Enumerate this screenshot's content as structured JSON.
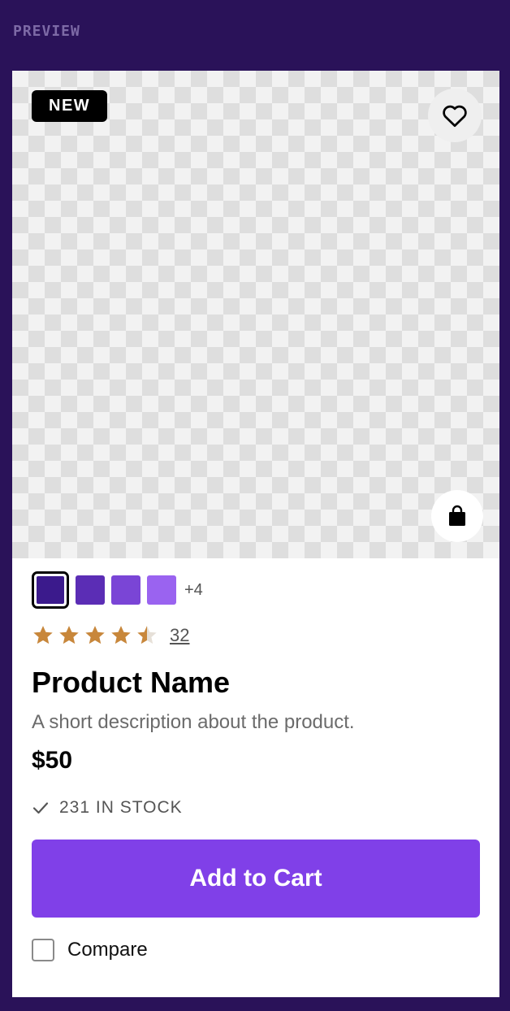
{
  "preview_label": "PREVIEW",
  "product": {
    "badge": "NEW",
    "title": "Product Name",
    "description": "A short description about the product.",
    "price": "$50",
    "rating": 4.5,
    "rating_max": 5,
    "review_count": "32",
    "stock_text": "231 IN STOCK",
    "swatches": [
      {
        "color": "#3b1a8c",
        "selected": true
      },
      {
        "color": "#5b2db5",
        "selected": false
      },
      {
        "color": "#7a45d6",
        "selected": false
      },
      {
        "color": "#9a63f0",
        "selected": false
      }
    ],
    "more_swatches": "+4",
    "add_to_cart_label": "Add to Cart",
    "compare_label": "Compare"
  },
  "colors": {
    "background": "#2a1259",
    "accent": "#8040e8",
    "star": "#c8873b"
  },
  "icons": [
    "heart-icon",
    "shopping-bag-icon",
    "check-icon",
    "star-icon"
  ]
}
